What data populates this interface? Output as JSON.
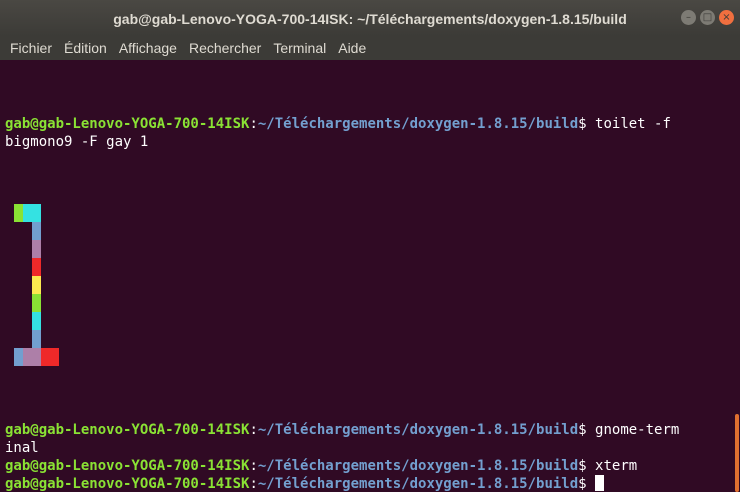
{
  "window": {
    "title": "gab@gab-Lenovo-YOGA-700-14ISK: ~/Téléchargements/doxygen-1.8.15/build"
  },
  "menu": [
    "Fichier",
    "Édition",
    "Affichage",
    "Rechercher",
    "Terminal",
    "Aide"
  ],
  "prompt": {
    "user": "gab@gab-Lenovo-YOGA-700-14ISK",
    "sep": ":",
    "path": "~/Téléchargements/doxygen-1.8.15/build",
    "dollar": "$"
  },
  "commands": {
    "toilet_line1": " toilet -f",
    "toilet_line2": "bigmono9 -F gay 1",
    "gnome_line1": " gnome-term",
    "gnome_line2": "inal",
    "xterm": " xterm"
  },
  "art": {
    "colors": {
      "green": "#8ae234",
      "cyan": "#34e2e2",
      "blue": "#729fcf",
      "mauve": "#ad7fa8",
      "red": "#ef2929",
      "yellow": "#fce94f"
    }
  }
}
